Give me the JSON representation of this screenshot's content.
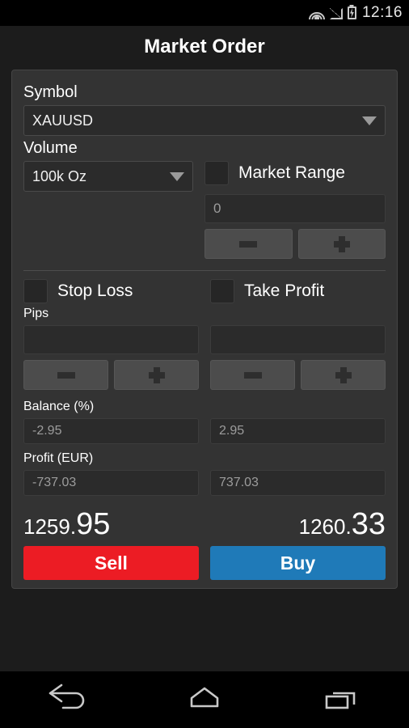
{
  "statusbar": {
    "time": "12:16",
    "icons": [
      "wifi-icon",
      "signal-icon",
      "battery-charging-icon"
    ]
  },
  "header": {
    "title": "Market Order"
  },
  "form": {
    "symbol": {
      "label": "Symbol",
      "value": "XAUUSD",
      "caret": "chevron-down-icon"
    },
    "volume": {
      "label": "Volume",
      "value": "100k Oz",
      "caret": "chevron-down-icon"
    },
    "market_range": {
      "label": "Market Range",
      "checked": false,
      "value": "0",
      "minus_label": "minus-icon",
      "plus_label": "plus-icon"
    },
    "stop_loss": {
      "label": "Stop Loss",
      "checked": false,
      "value": "",
      "minus_label": "minus-icon",
      "plus_label": "plus-icon"
    },
    "take_profit": {
      "label": "Take Profit",
      "checked": false,
      "value": "",
      "minus_label": "minus-icon",
      "plus_label": "plus-icon"
    },
    "pips_label": "Pips",
    "balance": {
      "label": "Balance (%)",
      "sell_value": "-2.95",
      "buy_value": "2.95"
    },
    "profit": {
      "label": "Profit (EUR)",
      "sell_value": "-737.03",
      "buy_value": "737.03"
    }
  },
  "quote": {
    "sell": {
      "price_int": "1259.",
      "price_dec": "95",
      "button_label": "Sell",
      "color": "#ec1c24"
    },
    "buy": {
      "price_int": "1260.",
      "price_dec": "33",
      "button_label": "Buy",
      "color": "#1f7ab8"
    }
  },
  "navbar": {
    "back": "back-icon",
    "home": "home-icon",
    "recents": "recents-icon"
  }
}
